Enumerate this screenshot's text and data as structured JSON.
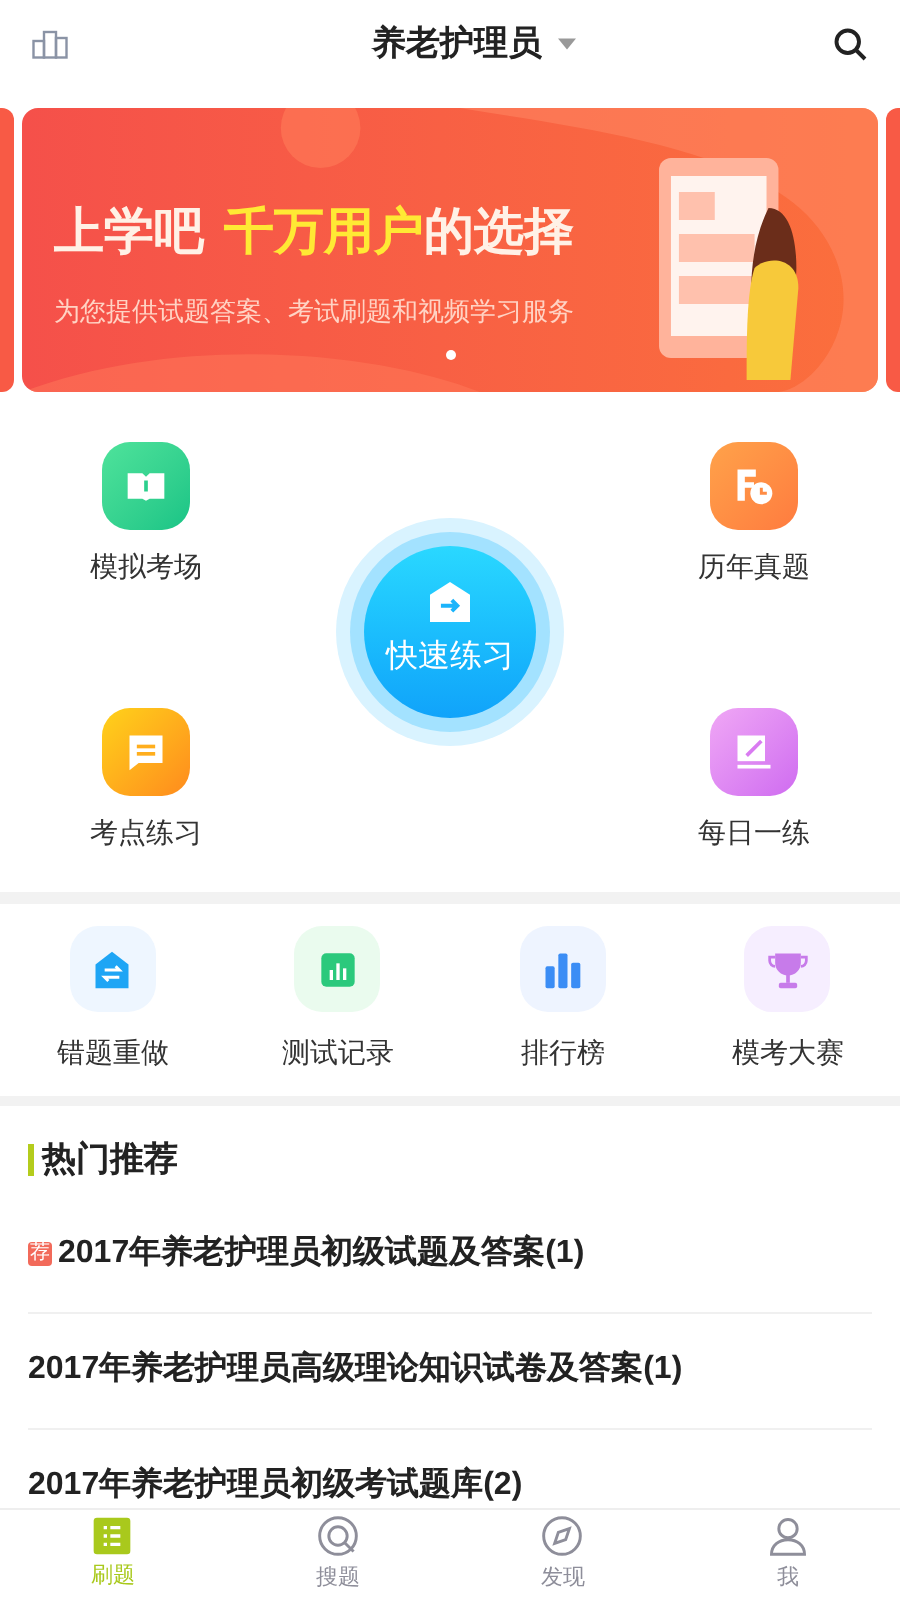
{
  "header": {
    "title": "养老护理员"
  },
  "banner": {
    "headline": "上学吧",
    "highlight": "千万用户",
    "headline_end": "的选择",
    "subtitle": "为您提供试题答案、考试刷题和视频学习服务",
    "dots": [
      {
        "selected": true
      }
    ]
  },
  "main_grid": {
    "items": [
      {
        "label": "模拟考场",
        "kind": "book"
      },
      {
        "label": "历年真题",
        "kind": "history"
      },
      {
        "label": "考点练习",
        "kind": "note"
      },
      {
        "label": "每日一练",
        "kind": "daily"
      }
    ],
    "center": {
      "label": "快速练习"
    }
  },
  "tools": [
    {
      "label": "错题重做",
      "kind": "redo"
    },
    {
      "label": "测试记录",
      "kind": "record"
    },
    {
      "label": "排行榜",
      "kind": "rank"
    },
    {
      "label": "模考大赛",
      "kind": "trophy"
    }
  ],
  "hot": {
    "title": "热门推荐",
    "items": [
      {
        "title": "2017年养老护理员初级试题及答案(1)",
        "badge": "荐"
      },
      {
        "title": "2017年养老护理员高级理论知识试卷及答案(1)"
      },
      {
        "title": "2017年养老护理员初级考试题库(2)"
      }
    ]
  },
  "tabs": [
    {
      "label": "刷题",
      "kind": "list",
      "selected": true
    },
    {
      "label": "搜题",
      "kind": "search",
      "selected": false
    },
    {
      "label": "发现",
      "kind": "compass",
      "selected": false
    },
    {
      "label": "我",
      "kind": "user",
      "selected": false
    }
  ]
}
